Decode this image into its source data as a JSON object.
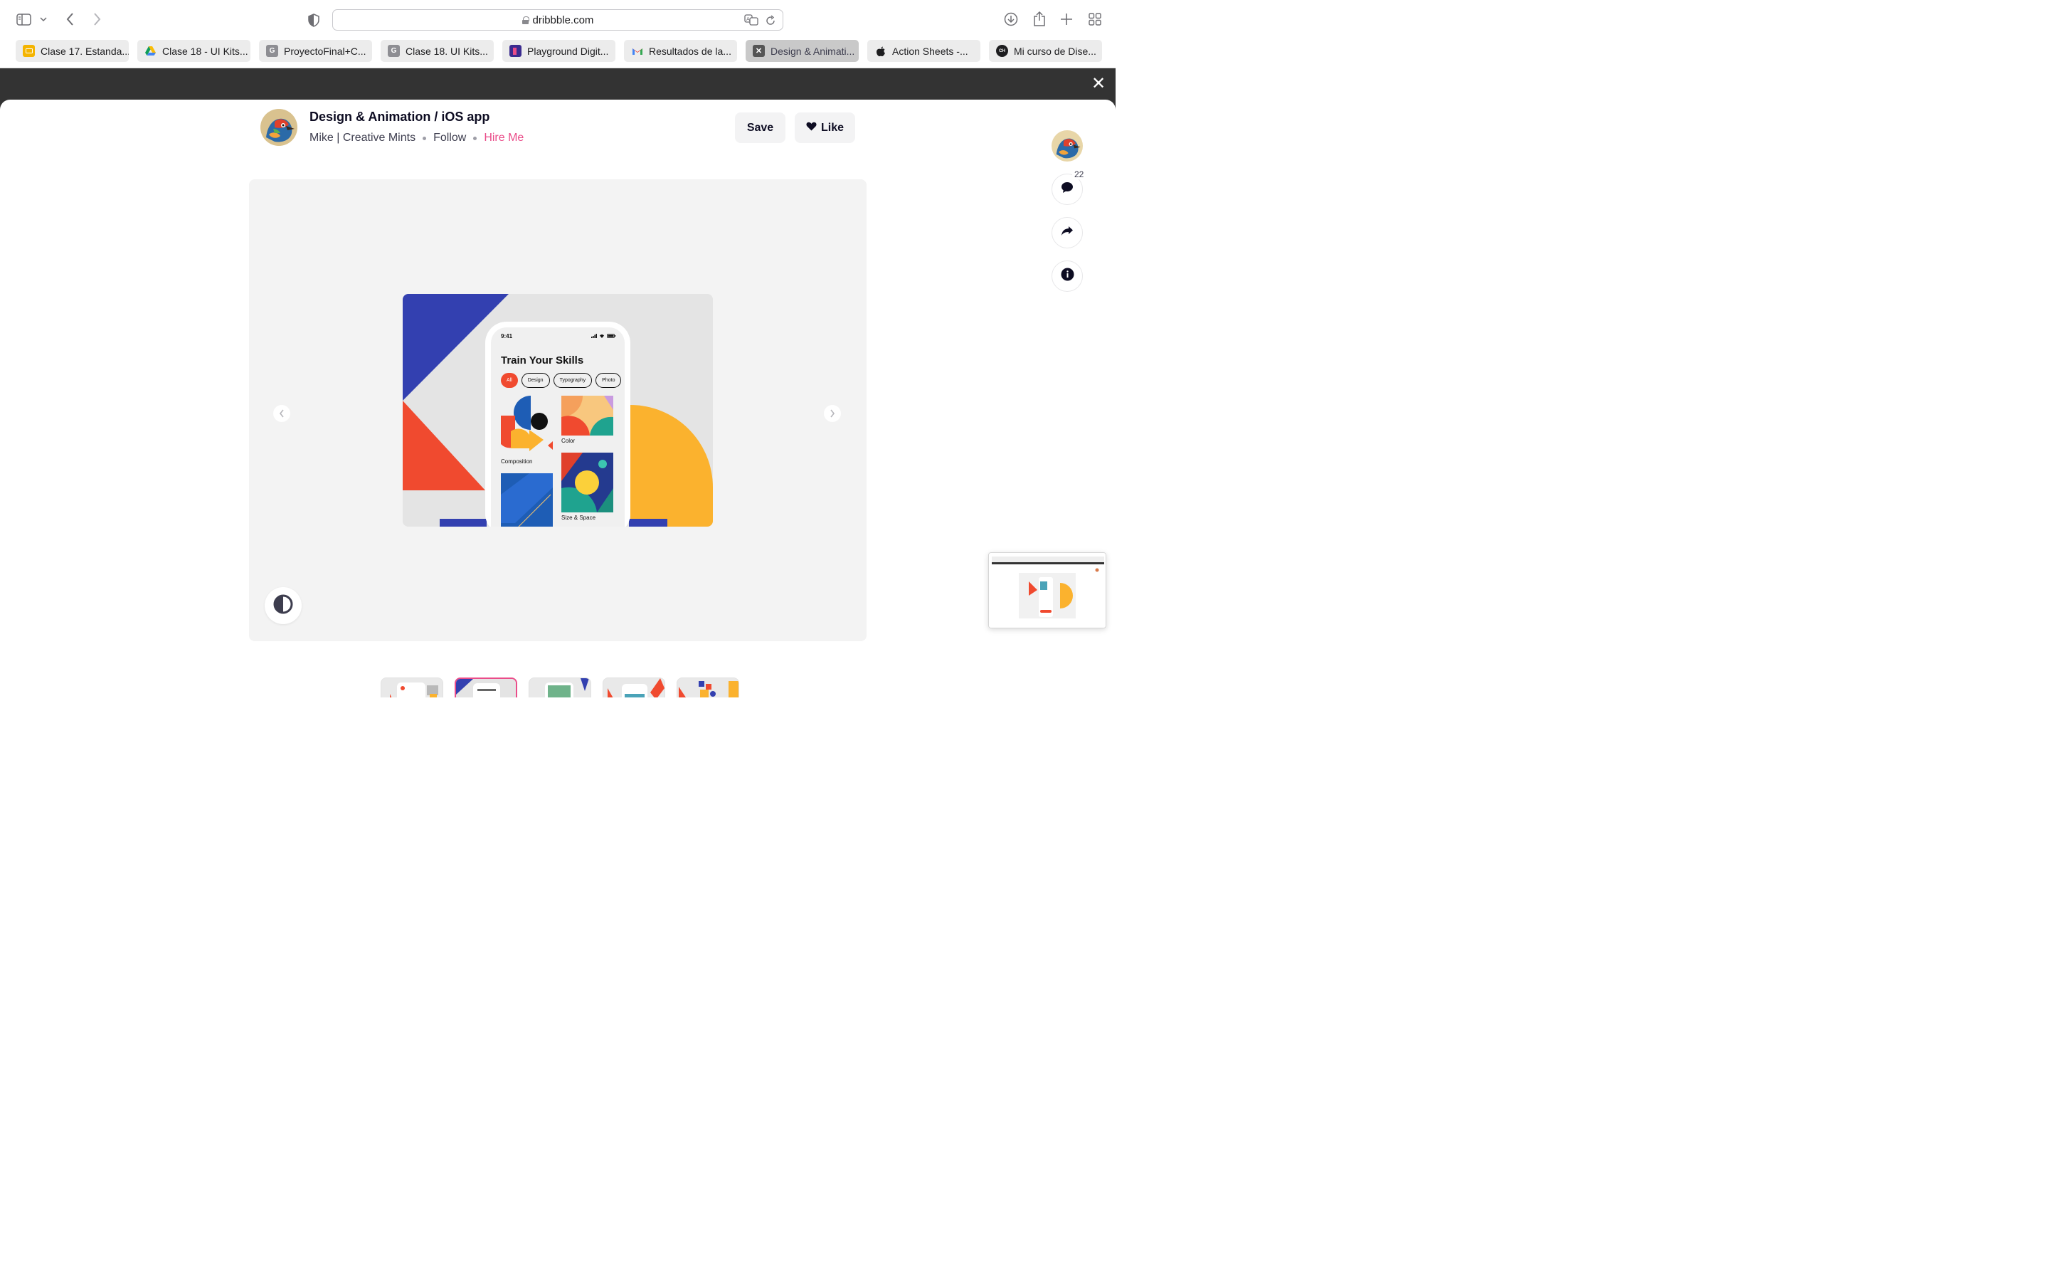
{
  "browser": {
    "url": "dribbble.com",
    "tabs": [
      {
        "label": "Clase 17. Estanda...",
        "favicon": "slides-icon",
        "color": "#f4b400"
      },
      {
        "label": "Clase 18 - UI Kits...",
        "favicon": "drive-icon",
        "color": "#1fa463"
      },
      {
        "label": "ProyectoFinal+C...",
        "favicon": "g-icon",
        "color": "#8e8e93"
      },
      {
        "label": "Clase 18. UI Kits...",
        "favicon": "g-icon",
        "color": "#8e8e93"
      },
      {
        "label": "Playground Digit...",
        "favicon": "playground-icon",
        "color": "#3b2b8f"
      },
      {
        "label": "Resultados de la...",
        "favicon": "gmail-icon",
        "color": "#ea4335"
      },
      {
        "label": "Design & Animati...",
        "favicon": "dribbble-icon",
        "color": "#555555",
        "active": true
      },
      {
        "label": "Action Sheets -...",
        "favicon": "apple-icon",
        "color": "#1d1d1f"
      },
      {
        "label": "Mi curso de Dise...",
        "favicon": "coder-icon",
        "color": "#1d1d1f"
      }
    ]
  },
  "shot": {
    "title": "Design & Animation / iOS app",
    "author": "Mike | Creative Mints",
    "follow_label": "Follow",
    "hire_label": "Hire Me",
    "save_label": "Save",
    "like_label": "Like",
    "comment_count": "22"
  },
  "phone": {
    "time": "9:41",
    "heading": "Train Your Skills",
    "chips": [
      "All",
      "Design",
      "Typography",
      "Photo"
    ],
    "cards": [
      "Composition",
      "Color",
      "Size & Space"
    ]
  },
  "colors": {
    "accent_pink": "#ea4c89",
    "art_blue": "#3340b0",
    "art_red": "#f04a2f",
    "art_yellow": "#fbb22e"
  }
}
